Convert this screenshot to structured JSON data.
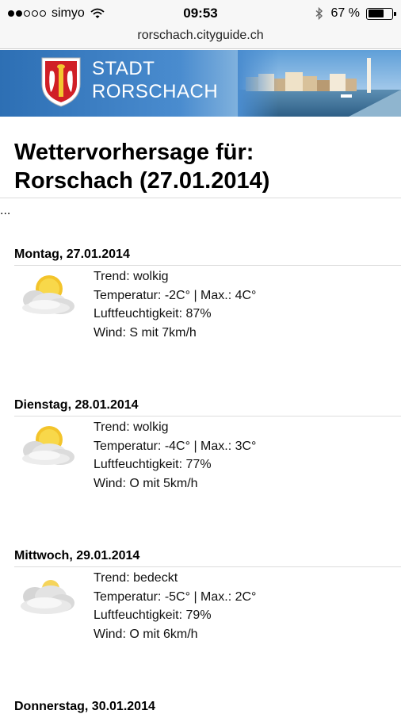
{
  "status_bar": {
    "signal_dots_filled": 2,
    "signal_dots_total": 5,
    "carrier": "simyo",
    "time": "09:53",
    "battery_percent_label": "67 %",
    "battery_level": 0.67
  },
  "url_bar": {
    "url": "rorschach.cityguide.ch"
  },
  "banner": {
    "line1": "STADT",
    "line2": "RORSCHACH",
    "colors": {
      "banner_blue": "#2d6fb4",
      "crest_red": "#d01f26"
    }
  },
  "page": {
    "title_line1": "Wettervorhersage für:",
    "title_line2": "Rorschach (27.01.2014)",
    "ellipsis": "..."
  },
  "forecast": [
    {
      "heading": "Montag, 27.01.2014",
      "icon": "partly-cloudy-icon",
      "trend": "Trend: wolkig",
      "temperature": "Temperatur: -2C° | Max.: 4C°",
      "humidity": "Luftfeuchtigkeit: 87%",
      "wind": "Wind: S mit 7km/h"
    },
    {
      "heading": "Dienstag, 28.01.2014",
      "icon": "partly-cloudy-icon",
      "trend": "Trend: wolkig",
      "temperature": "Temperatur: -4C° | Max.: 3C°",
      "humidity": "Luftfeuchtigkeit: 77%",
      "wind": "Wind: O mit 5km/h"
    },
    {
      "heading": "Mittwoch, 29.01.2014",
      "icon": "overcast-icon",
      "trend": "Trend: bedeckt",
      "temperature": "Temperatur: -5C° | Max.: 2C°",
      "humidity": "Luftfeuchtigkeit: 79%",
      "wind": "Wind: O mit 6km/h"
    },
    {
      "heading": "Donnerstag, 30.01.2014"
    }
  ]
}
